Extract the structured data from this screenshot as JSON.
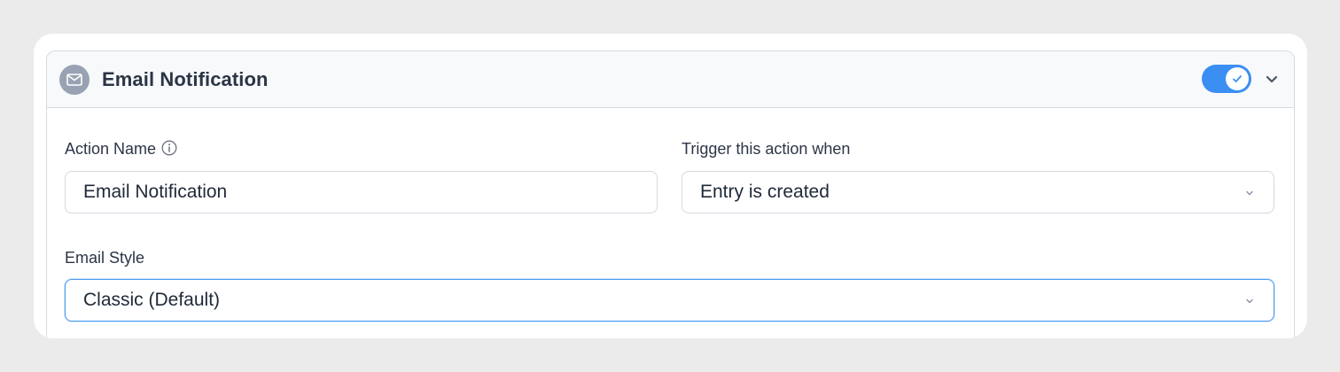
{
  "header": {
    "title": "Email Notification",
    "enabled": true,
    "icon": "envelope-icon",
    "collapse_icon": "chevron-down-icon"
  },
  "fields": {
    "action_name": {
      "label": "Action Name",
      "value": "Email Notification",
      "info_icon": "info-icon"
    },
    "trigger": {
      "label": "Trigger this action when",
      "selected": "Entry is created"
    },
    "email_style": {
      "label": "Email Style",
      "selected": "Classic (Default)"
    }
  },
  "colors": {
    "toggle_on": "#3b8ff2",
    "focus_border": "#4a9bf0",
    "badge": "#98a2b3"
  }
}
